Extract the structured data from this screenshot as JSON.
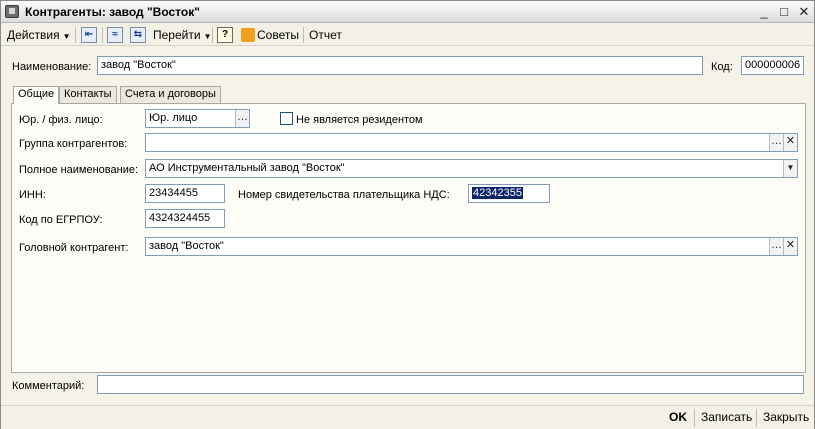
{
  "window": {
    "title": "Контрагенты: завод \"Восток\"",
    "controls": {
      "minimize": "_",
      "maximize": "□",
      "close": "✕"
    }
  },
  "toolbar": {
    "actions_label": "Действия",
    "goto_label": "Перейти",
    "help_label": "?",
    "tips_label": "Советы",
    "report_label": "Отчет",
    "icons": [
      "arrow-back-icon",
      "structure-icon",
      "swap-icon",
      "help-icon",
      "tips-icon"
    ]
  },
  "header": {
    "name_label": "Наименование:",
    "name_value": "завод \"Восток\"",
    "code_label": "Код:",
    "code_value": "000000006"
  },
  "tabs": [
    {
      "label": "Общие",
      "active": true
    },
    {
      "label": "Контакты",
      "active": false
    },
    {
      "label": "Счета и договоры",
      "active": false
    }
  ],
  "general": {
    "entity_type_label": "Юр. / физ. лицо:",
    "entity_type_value": "Юр. лицо",
    "non_resident_label": "Не является резидентом",
    "non_resident_checked": false,
    "group_label": "Группа контрагентов:",
    "group_value": "",
    "full_name_label": "Полное наименование:",
    "full_name_value": "АО Инструментальный завод \"Восток\"",
    "inn_label": "ИНН:",
    "inn_value": "23434455",
    "vat_cert_label": "Номер свидетельства плательщика НДС:",
    "vat_cert_value": "42342355",
    "edrpou_label": "Код по ЕГРПОУ:",
    "edrpou_value": "4324324455",
    "parent_label": "Головной контрагент:",
    "parent_value": "завод \"Восток\""
  },
  "footer": {
    "comment_label": "Комментарий:",
    "comment_value": ""
  },
  "bottom_buttons": {
    "ok_label": "OK",
    "save_label": "Записать",
    "close_label": "Закрыть"
  },
  "colors": {
    "selection": "#0a246a",
    "field_border": "#7f9db9",
    "panel_bg": "#fdfcf6"
  }
}
